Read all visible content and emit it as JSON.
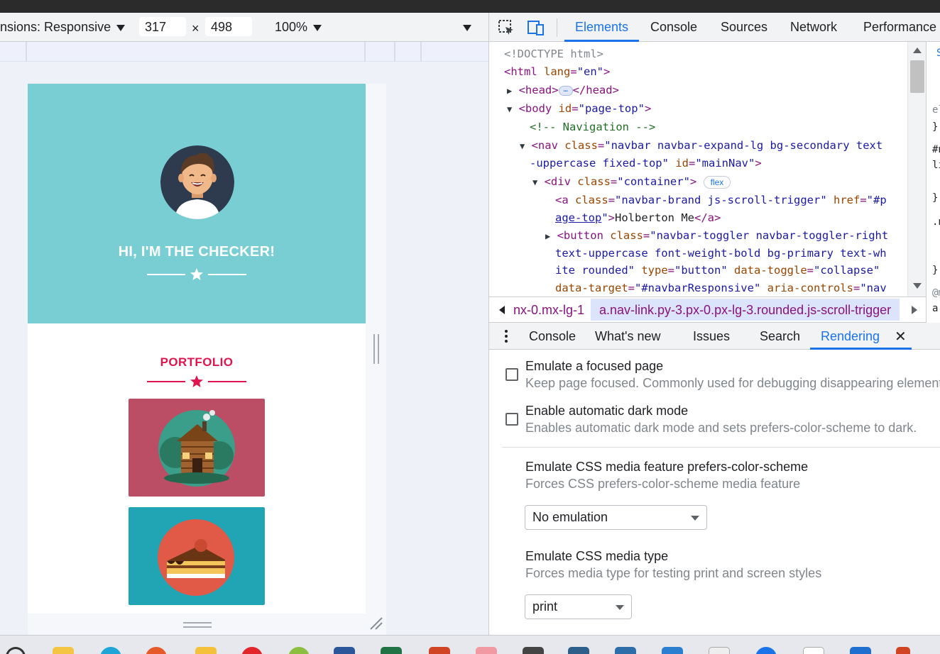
{
  "device_toolbar": {
    "dimensions_label": "nsions: Responsive",
    "width": "317",
    "height": "498",
    "times": "×",
    "zoom": "100%"
  },
  "page": {
    "heading": "HI, I'M THE CHECKER!",
    "portfolio_heading": "PORTFOLIO",
    "colors": {
      "masthead_bg": "#79ced3",
      "accent": "#e0144e",
      "portfolio_item_1": "#bb4d64",
      "portfolio_item_2": "#21a4b4"
    },
    "portfolio_items": [
      {
        "icon": "log-cabin-icon"
      },
      {
        "icon": "cake-slice-icon"
      }
    ]
  },
  "devtools": {
    "tabs": [
      "Elements",
      "Console",
      "Sources",
      "Network",
      "Performance"
    ],
    "active_tab": "Elements",
    "dom": {
      "doctype": "<!DOCTYPE html>",
      "html_open": "<html",
      "html_lang_attr": "lang",
      "html_lang_val": "\"en\"",
      "html_close": ">",
      "head_open": "<head>",
      "head_close": "</head>",
      "ellipsis": "…",
      "body_open": "<body",
      "body_id_attr": "id",
      "body_id_val": "\"page-top\"",
      "body_close": ">",
      "comment": "<!-- Navigation -->",
      "nav_open": "<nav",
      "nav_class_attr": "class",
      "nav_class_val_1": "\"navbar navbar-expand-lg bg-secondary text",
      "nav_class_val_2": "-uppercase fixed-top\"",
      "nav_id_attr": "id",
      "nav_id_val": "\"mainNav\"",
      "nav_close": ">",
      "div_open": "<div",
      "div_class_attr": "class",
      "div_class_val": "\"container\"",
      "div_close": ">",
      "flex_badge": "flex",
      "a_open": "<a",
      "a_class_attr": "class",
      "a_class_val": "\"navbar-brand js-scroll-trigger\"",
      "a_href_attr": "href",
      "a_href_val_1": "\"#p",
      "a_href_val_2": "age-top",
      "a_href_val_3": "\"",
      "a_close": ">",
      "a_text": "Holberton Me",
      "a_end": "</a>",
      "btn_open": "<button",
      "btn_class_attr": "class",
      "btn_class_val_1": "\"navbar-toggler navbar-toggler-right",
      "btn_class_val_2": "text-uppercase font-weight-bold bg-primary text-wh",
      "btn_class_val_3": "ite rounded\"",
      "btn_type_attr": "type",
      "btn_type_val": "\"button\"",
      "btn_toggle_attr": "data-toggle",
      "btn_toggle_val": "\"collapse\"",
      "btn_target_attr": "data-target",
      "btn_target_val": "\"#navbarResponsive\"",
      "btn_aria_attr": "aria-controls",
      "btn_aria_val": "\"nav"
    },
    "styles_fragments": [
      "el",
      "}",
      "#n",
      "li",
      "}",
      ".n",
      "}",
      "@m",
      "a"
    ],
    "breadcrumbs": {
      "prev": "nx-0.mx-lg-1",
      "current": "a.nav-link.py-3.px-0.px-lg-3.rounded.js-scroll-trigger"
    },
    "drawer_tabs": [
      "Console",
      "What's new",
      "Issues",
      "Search",
      "Rendering"
    ],
    "active_drawer_tab": "Rendering",
    "close_glyph": "✕",
    "rendering": {
      "focused_page_title": "Emulate a focused page",
      "focused_page_desc": "Keep page focused. Commonly used for debugging disappearing elements.",
      "dark_mode_title": "Enable automatic dark mode",
      "dark_mode_desc": "Enables automatic dark mode and sets prefers-color-scheme to dark.",
      "color_scheme_title": "Emulate CSS media feature prefers-color-scheme",
      "color_scheme_desc": "Forces CSS prefers-color-scheme media feature",
      "color_scheme_value": "No emulation",
      "media_type_title": "Emulate CSS media type",
      "media_type_desc": "Forces media type for testing print and screen styles",
      "media_type_value": "print"
    }
  }
}
